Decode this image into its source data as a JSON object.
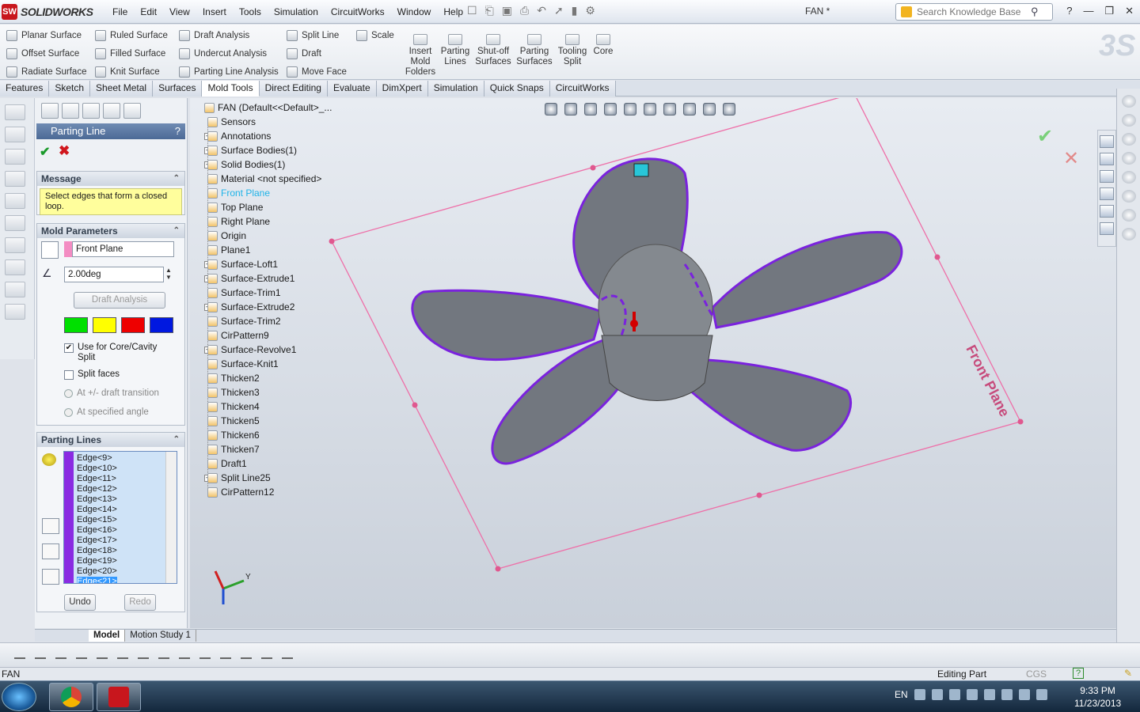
{
  "app": {
    "name": "SOLIDWORKS",
    "doc_title": "FAN *"
  },
  "menu": [
    "File",
    "Edit",
    "View",
    "Insert",
    "Tools",
    "Simulation",
    "CircuitWorks",
    "Window",
    "Help"
  ],
  "search": {
    "placeholder": "Search Knowledge Base"
  },
  "command_manager": {
    "col1": [
      "Planar Surface",
      "Offset Surface",
      "Radiate Surface"
    ],
    "col2": [
      "Ruled Surface",
      "Filled Surface",
      "Knit Surface"
    ],
    "col3": [
      "Draft Analysis",
      "Undercut Analysis",
      "Parting Line Analysis"
    ],
    "col4": [
      "Split Line",
      "Draft",
      "Move Face"
    ],
    "col5": [
      "Scale"
    ],
    "big": [
      "Insert Mold Folders",
      "Parting Lines",
      "Shut-off Surfaces",
      "Parting Surfaces",
      "Tooling Split",
      "Core"
    ]
  },
  "tabs": [
    "Features",
    "Sketch",
    "Sheet Metal",
    "Surfaces",
    "Mold Tools",
    "Direct Editing",
    "Evaluate",
    "DimXpert",
    "Simulation",
    "Quick Snaps",
    "CircuitWorks"
  ],
  "active_tab": "Mold Tools",
  "property_manager": {
    "title": "Parting Line",
    "help": "?",
    "message_header": "Message",
    "message": "Select edges that form a closed loop.",
    "mold_params_header": "Mold Parameters",
    "direction": "Front Plane",
    "angle": "2.00deg",
    "draft_analysis": "Draft Analysis",
    "use_core_cavity": "Use for Core/Cavity Split",
    "split_faces": "Split faces",
    "at_draft_transition": "At +/- draft transition",
    "at_specified_angle": "At specified angle",
    "parting_lines_header": "Parting Lines",
    "edges": [
      "Edge<9>",
      "Edge<10>",
      "Edge<11>",
      "Edge<12>",
      "Edge<13>",
      "Edge<14>",
      "Edge<15>",
      "Edge<16>",
      "Edge<17>",
      "Edge<18>",
      "Edge<19>",
      "Edge<20>",
      "Edge<21>"
    ],
    "undo": "Undo",
    "redo": "Redo",
    "colors": [
      "#00e000",
      "#ffff00",
      "#ee0000",
      "#0018e0"
    ]
  },
  "tree": {
    "root": "FAN  (Default<<Default>_...",
    "items": [
      "Sensors",
      "Annotations",
      "Surface Bodies(1)",
      "Solid Bodies(1)",
      "Material <not specified>",
      "Front Plane",
      "Top Plane",
      "Right Plane",
      "Origin",
      "Plane1",
      "Surface-Loft1",
      "Surface-Extrude1",
      "Surface-Trim1",
      "Surface-Extrude2",
      "Surface-Trim2",
      "CirPattern9",
      "Surface-Revolve1",
      "Surface-Knit1",
      "Thicken2",
      "Thicken3",
      "Thicken4",
      "Thicken5",
      "Thicken6",
      "Thicken7",
      "Draft1",
      "Split Line25",
      "CirPattern12"
    ]
  },
  "viewport": {
    "plane_label": "Front Plane",
    "axis_y": "Y"
  },
  "bottom_tabs": [
    "Model",
    "Motion Study 1"
  ],
  "status": {
    "left": "FAN",
    "mode": "Editing Part",
    "units": "CGS",
    "help": "?"
  },
  "taskbar": {
    "lang": "EN",
    "time": "9:33 PM",
    "date": "11/23/2013"
  }
}
